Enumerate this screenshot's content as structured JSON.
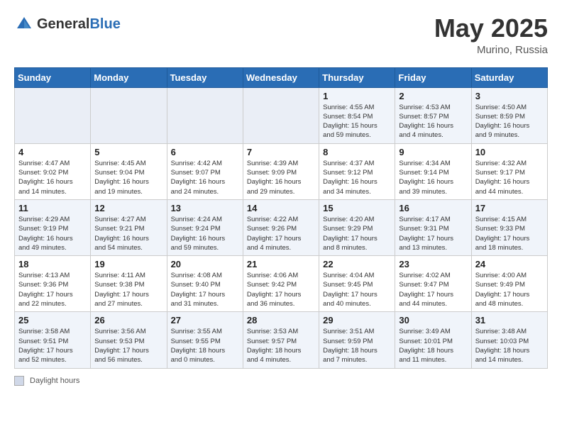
{
  "header": {
    "logo_general": "General",
    "logo_blue": "Blue",
    "month_year": "May 2025",
    "location": "Murino, Russia"
  },
  "weekdays": [
    "Sunday",
    "Monday",
    "Tuesday",
    "Wednesday",
    "Thursday",
    "Friday",
    "Saturday"
  ],
  "footer_legend": "Daylight hours",
  "weeks": [
    [
      {
        "day": "",
        "info": ""
      },
      {
        "day": "",
        "info": ""
      },
      {
        "day": "",
        "info": ""
      },
      {
        "day": "",
        "info": ""
      },
      {
        "day": "1",
        "info": "Sunrise: 4:55 AM\nSunset: 8:54 PM\nDaylight: 15 hours\nand 59 minutes."
      },
      {
        "day": "2",
        "info": "Sunrise: 4:53 AM\nSunset: 8:57 PM\nDaylight: 16 hours\nand 4 minutes."
      },
      {
        "day": "3",
        "info": "Sunrise: 4:50 AM\nSunset: 8:59 PM\nDaylight: 16 hours\nand 9 minutes."
      }
    ],
    [
      {
        "day": "4",
        "info": "Sunrise: 4:47 AM\nSunset: 9:02 PM\nDaylight: 16 hours\nand 14 minutes."
      },
      {
        "day": "5",
        "info": "Sunrise: 4:45 AM\nSunset: 9:04 PM\nDaylight: 16 hours\nand 19 minutes."
      },
      {
        "day": "6",
        "info": "Sunrise: 4:42 AM\nSunset: 9:07 PM\nDaylight: 16 hours\nand 24 minutes."
      },
      {
        "day": "7",
        "info": "Sunrise: 4:39 AM\nSunset: 9:09 PM\nDaylight: 16 hours\nand 29 minutes."
      },
      {
        "day": "8",
        "info": "Sunrise: 4:37 AM\nSunset: 9:12 PM\nDaylight: 16 hours\nand 34 minutes."
      },
      {
        "day": "9",
        "info": "Sunrise: 4:34 AM\nSunset: 9:14 PM\nDaylight: 16 hours\nand 39 minutes."
      },
      {
        "day": "10",
        "info": "Sunrise: 4:32 AM\nSunset: 9:17 PM\nDaylight: 16 hours\nand 44 minutes."
      }
    ],
    [
      {
        "day": "11",
        "info": "Sunrise: 4:29 AM\nSunset: 9:19 PM\nDaylight: 16 hours\nand 49 minutes."
      },
      {
        "day": "12",
        "info": "Sunrise: 4:27 AM\nSunset: 9:21 PM\nDaylight: 16 hours\nand 54 minutes."
      },
      {
        "day": "13",
        "info": "Sunrise: 4:24 AM\nSunset: 9:24 PM\nDaylight: 16 hours\nand 59 minutes."
      },
      {
        "day": "14",
        "info": "Sunrise: 4:22 AM\nSunset: 9:26 PM\nDaylight: 17 hours\nand 4 minutes."
      },
      {
        "day": "15",
        "info": "Sunrise: 4:20 AM\nSunset: 9:29 PM\nDaylight: 17 hours\nand 8 minutes."
      },
      {
        "day": "16",
        "info": "Sunrise: 4:17 AM\nSunset: 9:31 PM\nDaylight: 17 hours\nand 13 minutes."
      },
      {
        "day": "17",
        "info": "Sunrise: 4:15 AM\nSunset: 9:33 PM\nDaylight: 17 hours\nand 18 minutes."
      }
    ],
    [
      {
        "day": "18",
        "info": "Sunrise: 4:13 AM\nSunset: 9:36 PM\nDaylight: 17 hours\nand 22 minutes."
      },
      {
        "day": "19",
        "info": "Sunrise: 4:11 AM\nSunset: 9:38 PM\nDaylight: 17 hours\nand 27 minutes."
      },
      {
        "day": "20",
        "info": "Sunrise: 4:08 AM\nSunset: 9:40 PM\nDaylight: 17 hours\nand 31 minutes."
      },
      {
        "day": "21",
        "info": "Sunrise: 4:06 AM\nSunset: 9:42 PM\nDaylight: 17 hours\nand 36 minutes."
      },
      {
        "day": "22",
        "info": "Sunrise: 4:04 AM\nSunset: 9:45 PM\nDaylight: 17 hours\nand 40 minutes."
      },
      {
        "day": "23",
        "info": "Sunrise: 4:02 AM\nSunset: 9:47 PM\nDaylight: 17 hours\nand 44 minutes."
      },
      {
        "day": "24",
        "info": "Sunrise: 4:00 AM\nSunset: 9:49 PM\nDaylight: 17 hours\nand 48 minutes."
      }
    ],
    [
      {
        "day": "25",
        "info": "Sunrise: 3:58 AM\nSunset: 9:51 PM\nDaylight: 17 hours\nand 52 minutes."
      },
      {
        "day": "26",
        "info": "Sunrise: 3:56 AM\nSunset: 9:53 PM\nDaylight: 17 hours\nand 56 minutes."
      },
      {
        "day": "27",
        "info": "Sunrise: 3:55 AM\nSunset: 9:55 PM\nDaylight: 18 hours\nand 0 minutes."
      },
      {
        "day": "28",
        "info": "Sunrise: 3:53 AM\nSunset: 9:57 PM\nDaylight: 18 hours\nand 4 minutes."
      },
      {
        "day": "29",
        "info": "Sunrise: 3:51 AM\nSunset: 9:59 PM\nDaylight: 18 hours\nand 7 minutes."
      },
      {
        "day": "30",
        "info": "Sunrise: 3:49 AM\nSunset: 10:01 PM\nDaylight: 18 hours\nand 11 minutes."
      },
      {
        "day": "31",
        "info": "Sunrise: 3:48 AM\nSunset: 10:03 PM\nDaylight: 18 hours\nand 14 minutes."
      }
    ]
  ]
}
